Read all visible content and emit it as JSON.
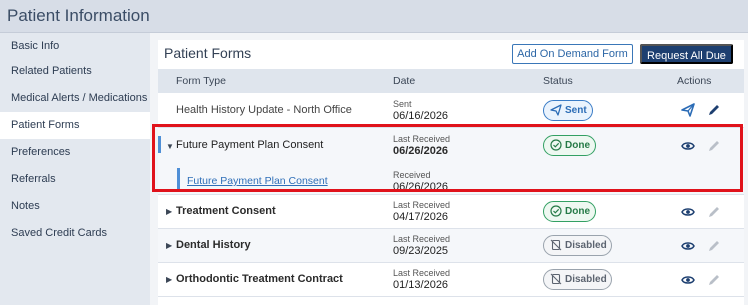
{
  "window": {
    "title": "Patient Information"
  },
  "sidebar": {
    "items": [
      {
        "label": "Basic Info"
      },
      {
        "label": "Related Patients"
      },
      {
        "label": "Medical Alerts / Medications"
      },
      {
        "label": "Patient Forms",
        "active": true
      },
      {
        "label": "Preferences"
      },
      {
        "label": "Referrals"
      },
      {
        "label": "Notes"
      },
      {
        "label": "Saved Credit Cards"
      }
    ]
  },
  "panel": {
    "title": "Patient Forms",
    "add_on_demand_label": "Add On Demand Form",
    "request_all_due_label": "Request All Due"
  },
  "table": {
    "headers": {
      "form_type": "Form Type",
      "date": "Date",
      "status": "Status",
      "actions": "Actions"
    },
    "rows": [
      {
        "form_type": "Health History Update - North Office",
        "date_label": "Sent",
        "date": "06/16/2026",
        "status": "Sent",
        "status_type": "sent",
        "actions": [
          "send-icon",
          "pencil-icon"
        ]
      },
      {
        "form_type": "Future Payment Plan Consent",
        "date_label": "Last Received",
        "date": "06/26/2026",
        "status": "Done",
        "status_type": "done",
        "expanded": true,
        "actions": [
          "view-icon",
          "pencil-icon"
        ],
        "sub": {
          "link": "Future Payment Plan Consent",
          "date_label": "Received",
          "date": "06/26/2026"
        }
      },
      {
        "form_type": "Treatment Consent",
        "date_label": "Last Received",
        "date": "04/17/2026",
        "status": "Done",
        "status_type": "done",
        "actions": [
          "view-icon",
          "pencil-icon"
        ]
      },
      {
        "form_type": "Dental History",
        "date_label": "Last Received",
        "date": "09/23/2025",
        "status": "Disabled",
        "status_type": "disabled",
        "actions": [
          "view-icon",
          "pencil-icon"
        ]
      },
      {
        "form_type": "Orthodontic Treatment Contract",
        "date_label": "Last Received",
        "date": "01/13/2026",
        "status": "Disabled",
        "status_type": "disabled",
        "actions": [
          "view-icon",
          "pencil-icon"
        ]
      }
    ]
  },
  "colors": {
    "accent": "#1d3f70",
    "sent": "#3a7cc6",
    "done": "#33a063",
    "disabled": "#9aa3ad",
    "highlight": "#e0121b"
  }
}
